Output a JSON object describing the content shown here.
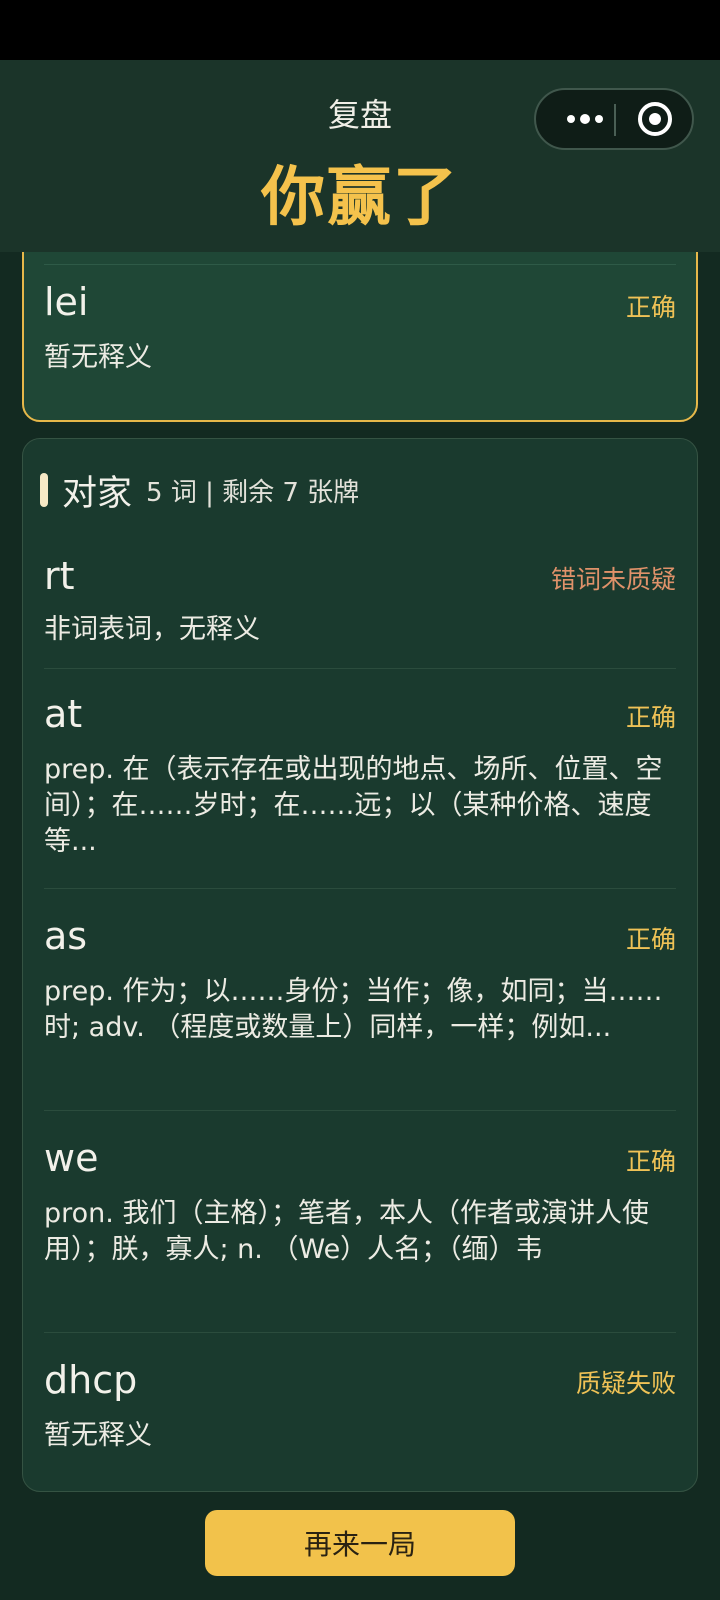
{
  "nav": {
    "title": "复盘",
    "more_icon": "more-dots-icon",
    "close_icon": "target-close-icon"
  },
  "result": {
    "title": "你赢了"
  },
  "colors": {
    "accent": "#f4c24c",
    "background": "#132a21",
    "card": "#1a3a2e",
    "warn": "#e0926a"
  },
  "self_card": {
    "words": [
      {
        "word": "lei",
        "status": "正确",
        "definition": "暂无释义"
      }
    ]
  },
  "opponent": {
    "name": "对家",
    "stats": "5 词 | 剩余 7 张牌",
    "words": [
      {
        "word": "rt",
        "status": "错词未质疑",
        "definition": "非词表词，无释义"
      },
      {
        "word": "at",
        "status": "正确",
        "definition": "prep. 在（表示存在或出现的地点、场所、位置、空间）；在……岁时；在……远；以（某种价格、速度等..."
      },
      {
        "word": "as",
        "status": "正确",
        "definition": "prep. 作为；以……身份；当作；像，如同；当……时; adv. （程度或数量上）同样，一样；例如..."
      },
      {
        "word": "we",
        "status": "正确",
        "definition": "pron. 我们（主格）；笔者，本人（作者或演讲人使用）；朕，寡人; n. （We）人名；（缅）韦"
      },
      {
        "word": "dhcp",
        "status": "质疑失败",
        "definition": "暂无释义"
      }
    ]
  },
  "actions": {
    "play_again": "再来一局"
  }
}
